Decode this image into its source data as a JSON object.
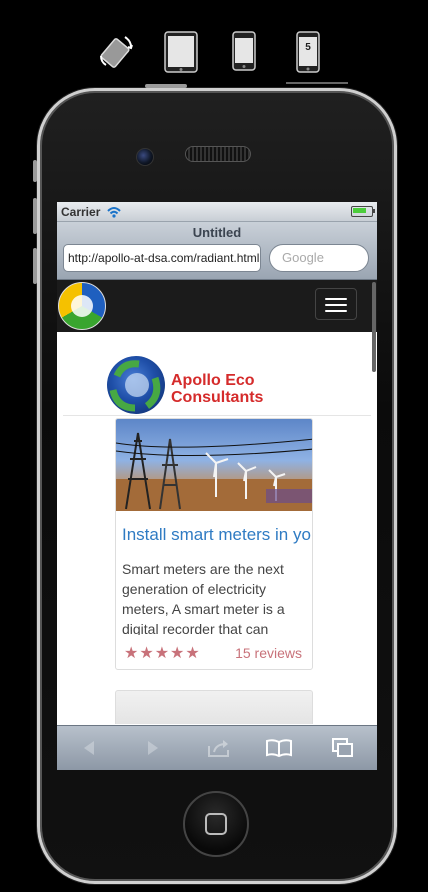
{
  "device_toolbar": {
    "rotate_icon": "rotate-device-icon",
    "ipad_icon": "ipad-icon",
    "iphone4_icon": "iphone-icon",
    "iphone5_label": "5"
  },
  "status_bar": {
    "carrier": "Carrier",
    "wifi_icon": "wifi-icon",
    "battery_level": 0.8
  },
  "browser": {
    "page_title": "Untitled",
    "url": "http://apollo-at-dsa.com/radiant.html",
    "search_placeholder": "Google"
  },
  "site_header": {
    "logo_icon": "apollo-globe-logo",
    "menu_icon": "hamburger-menu-icon"
  },
  "brand": {
    "line1": "Apollo Eco",
    "line2": "Consultants"
  },
  "article": {
    "title": "Install smart meters in your home",
    "excerpt": "Smart meters are the next generation of electricity meters, A smart meter is a digital recorder that can measure",
    "rating": 5,
    "stars": "★★★★★",
    "reviews": "15 reviews"
  },
  "toolbar": {
    "back_icon": "back-arrow-icon",
    "forward_icon": "forward-arrow-icon",
    "share_icon": "share-icon",
    "bookmarks_icon": "bookmarks-book-icon",
    "tabs_icon": "tabs-icon"
  },
  "colors": {
    "link_blue": "#2f7bc3",
    "rating_pink": "#c8727a",
    "brand_red": "#d52b2b",
    "navbar_dark": "#1b1b1b"
  }
}
